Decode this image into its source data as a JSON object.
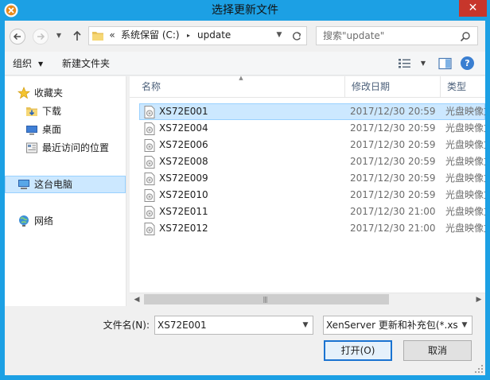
{
  "window": {
    "title": "选择更新文件",
    "close_glyph": "✕"
  },
  "nav": {
    "path": [
      "系统保留 (C:)",
      "update"
    ],
    "overflow": "«",
    "separator": "▸"
  },
  "search": {
    "placeholder": "搜索\"update\""
  },
  "toolbar": {
    "organize_label": "组织",
    "new_folder_label": "新建文件夹",
    "help_glyph": "?"
  },
  "sidebar": {
    "items": [
      {
        "label": "收藏夹",
        "icon": "star-icon"
      },
      {
        "label": "下载",
        "icon": "download-folder-icon"
      },
      {
        "label": "桌面",
        "icon": "desktop-icon"
      },
      {
        "label": "最近访问的位置",
        "icon": "recent-places-icon"
      },
      {
        "label": "这台电脑",
        "icon": "computer-icon",
        "selected": true
      },
      {
        "label": "网络",
        "icon": "network-icon"
      }
    ]
  },
  "columns": {
    "name": "名称",
    "modified": "修改日期",
    "type": "类型"
  },
  "files": [
    {
      "name": "XS72E001",
      "modified": "2017/12/30 20:59",
      "type": "光盘映像文件",
      "selected": true
    },
    {
      "name": "XS72E004",
      "modified": "2017/12/30 20:59",
      "type": "光盘映像文件"
    },
    {
      "name": "XS72E006",
      "modified": "2017/12/30 20:59",
      "type": "光盘映像文件"
    },
    {
      "name": "XS72E008",
      "modified": "2017/12/30 20:59",
      "type": "光盘映像文件"
    },
    {
      "name": "XS72E009",
      "modified": "2017/12/30 20:59",
      "type": "光盘映像文件"
    },
    {
      "name": "XS72E010",
      "modified": "2017/12/30 20:59",
      "type": "光盘映像文件"
    },
    {
      "name": "XS72E011",
      "modified": "2017/12/30 21:00",
      "type": "光盘映像文件"
    },
    {
      "name": "XS72E012",
      "modified": "2017/12/30 21:00",
      "type": "光盘映像文件"
    }
  ],
  "footer": {
    "filename_label": "文件名(N):",
    "filename_value": "XS72E001",
    "filetype_value": "XenServer 更新和补充包(*.xsu",
    "open_label": "打开(O)",
    "cancel_label": "取消"
  },
  "colors": {
    "title_bar": "#1ca0e4",
    "close_button": "#c7362b",
    "selection": "#cce8ff",
    "selection_border": "#99d1ff",
    "default_button_border": "#1a73d1"
  }
}
